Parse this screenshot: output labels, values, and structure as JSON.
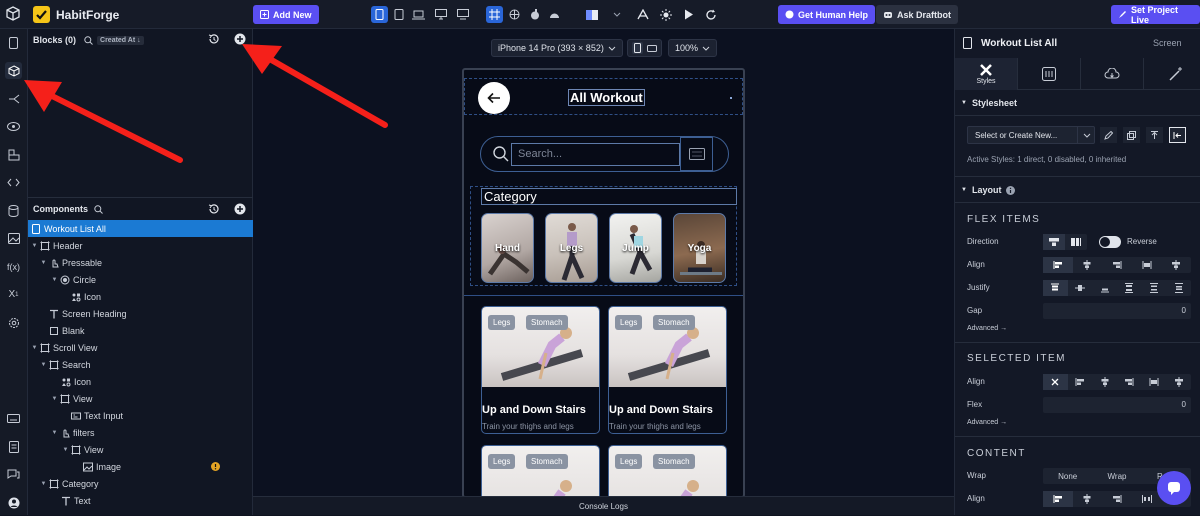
{
  "app": {
    "name": "HabitForge"
  },
  "toolbar": {
    "add_new": "Add New",
    "get_help": "Get Human Help",
    "ask_ai": "Ask Draftbot",
    "set_live": "Set Project Live"
  },
  "blocks": {
    "title": "Blocks (0)",
    "sort": "Created At ↓"
  },
  "components": {
    "title": "Components",
    "tree": [
      {
        "label": "Workout List All"
      },
      {
        "label": "Header"
      },
      {
        "label": "Pressable"
      },
      {
        "label": "Circle"
      },
      {
        "label": "Icon"
      },
      {
        "label": "Screen Heading"
      },
      {
        "label": "Blank"
      },
      {
        "label": "Scroll View"
      },
      {
        "label": "Search"
      },
      {
        "label": "Icon"
      },
      {
        "label": "View"
      },
      {
        "label": "Text Input"
      },
      {
        "label": "filters"
      },
      {
        "label": "View"
      },
      {
        "label": "Image"
      },
      {
        "label": "Category"
      },
      {
        "label": "Text"
      }
    ]
  },
  "canvas": {
    "device": "iPhone 14 Pro (393 × 852)",
    "zoom": "100%",
    "screen_title": "All Workout",
    "search_placeholder": "Search...",
    "category_heading": "Category",
    "categories": [
      "Hand",
      "Legs",
      "Jump",
      "Yoga"
    ],
    "workout_title": "Up and Down Stairs",
    "workout_sub": "Train your thighs and legs",
    "tags": [
      "Legs",
      "Stomach"
    ]
  },
  "console": {
    "label": "Console Logs"
  },
  "inspector": {
    "title": "Workout List All",
    "screen": "Screen",
    "styles_tab": "Styles",
    "stylesheet": "Stylesheet",
    "select_create": "Select or Create New...",
    "active_styles": "Active Styles: 1 direct, 0 disabled, 0 inherited",
    "layout": "Layout",
    "flex_items": "FLEX ITEMS",
    "direction": "Direction",
    "reverse": "Reverse",
    "align": "Align",
    "justify": "Justify",
    "gap": "Gap",
    "gap_value": "0",
    "advanced": "Advanced →",
    "selected_item": "SELECTED ITEM",
    "flex": "Flex",
    "flex_value": "0",
    "content": "CONTENT",
    "wrap": "Wrap",
    "wrap_options": [
      "None",
      "Wrap",
      "Reve"
    ]
  }
}
